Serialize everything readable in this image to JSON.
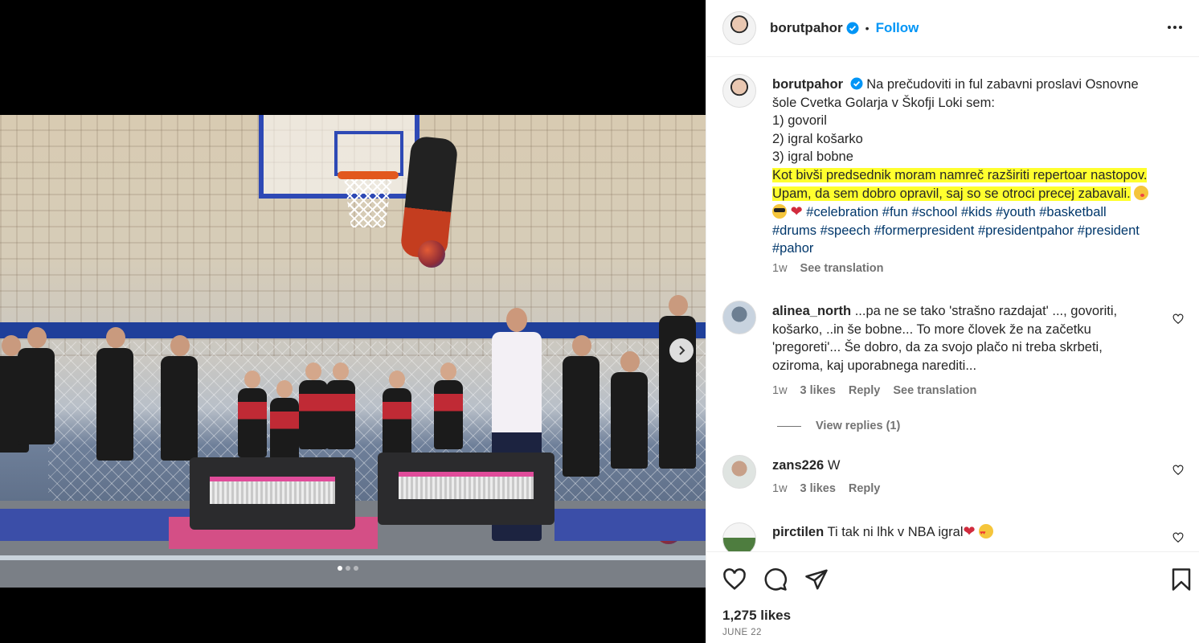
{
  "post": {
    "username": "borutpahor",
    "follow_label": "Follow",
    "separator": "•",
    "caption_user": "borutpahor",
    "caption_lines": [
      "Na prečudoviti in ful zabavni proslavi Osnovne",
      "šole Cvetka Golarja v Škofji Loki sem:",
      "1) govoril",
      "2) igral košarko",
      "3) igral bobne"
    ],
    "caption_highlight_1": "Kot bivši predsednik moram namreč razširiti repertoar nastopov.",
    "caption_highlight_2": "Upam, da sem dobro opravil, saj so se otroci precej zabavali.",
    "hashtags_line1": [
      "#celebration",
      "#fun",
      "#school",
      "#kids",
      "#youth",
      "#basketball"
    ],
    "hashtags_line2": [
      "#drums",
      "#speech",
      "#formerpresident",
      "#presidentpahor",
      "#president"
    ],
    "hashtags_line3": [
      "#pahor"
    ],
    "caption_time": "1w",
    "see_translation": "See translation",
    "likes": "1,275 likes",
    "date": "JUNE 22"
  },
  "comments": [
    {
      "user": "alinea_north",
      "lines": [
        "...pa ne se tako 'strašno razdajat' ..., govoriti,",
        "košarko, ..in še bobne... To more človek že na začetku",
        "'pregoreti'... Še dobro, da za svojo plačo ni treba skrbeti,",
        "oziroma, kaj uporabnega narediti..."
      ],
      "time": "1w",
      "likes": "3 likes",
      "reply": "Reply",
      "translate": "See translation",
      "view_replies": "View replies (1)"
    },
    {
      "user": "zans226",
      "text": "W",
      "time": "1w",
      "likes": "3 likes",
      "reply": "Reply"
    },
    {
      "user": "pirctilen",
      "text": "Ti tak ni lhk v NBA igral"
    }
  ],
  "icons": {
    "verified": "verified-badge-icon",
    "more": "more-options-icon",
    "like": "heart-icon",
    "comment": "comment-icon",
    "share": "share-icon",
    "save": "bookmark-icon",
    "next": "chevron-right-icon"
  },
  "colors": {
    "accent": "#0095f6",
    "highlight": "#ffff2e",
    "hashtag": "#00376b",
    "muted": "#737373"
  },
  "carousel": {
    "slides": 3,
    "active": 1
  }
}
